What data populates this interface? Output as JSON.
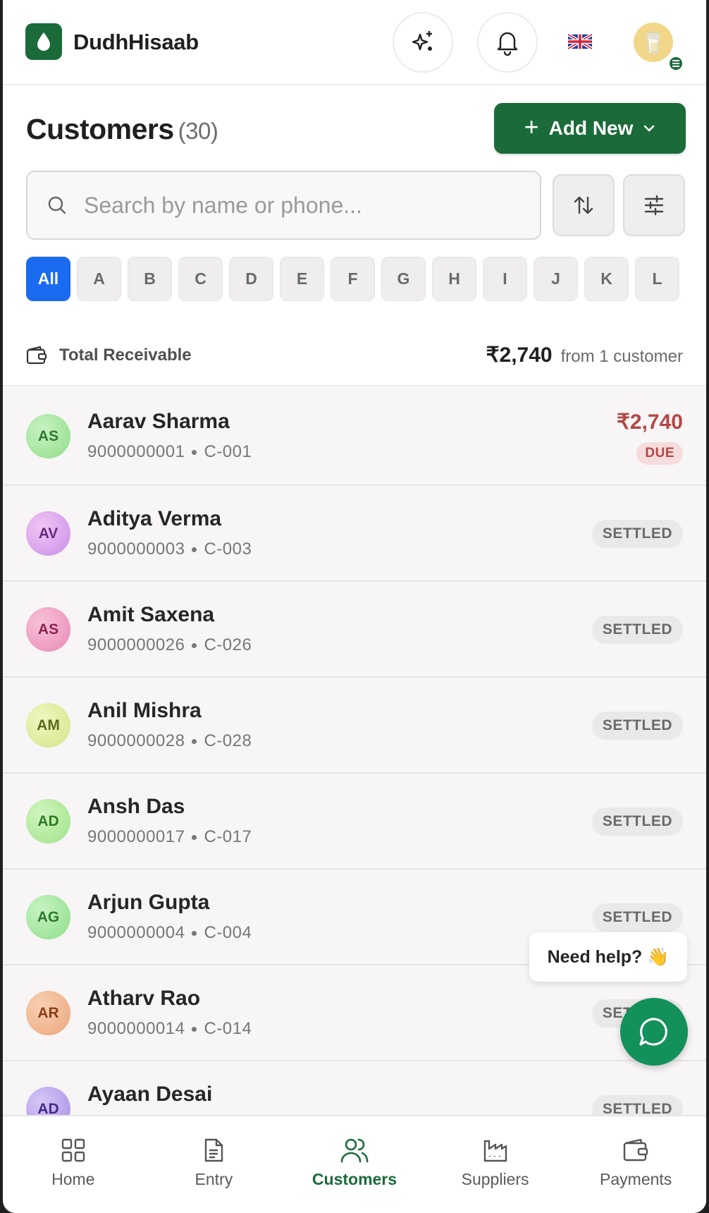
{
  "header": {
    "brand": "DudhHisaab",
    "profile_emoji": "🥛"
  },
  "page": {
    "title": "Customers",
    "count": "(30)",
    "add_new_label": "Add New"
  },
  "search": {
    "placeholder": "Search by name or phone..."
  },
  "alphabet": [
    "All",
    "A",
    "B",
    "C",
    "D",
    "E",
    "F",
    "G",
    "H",
    "I",
    "J",
    "K",
    "L"
  ],
  "receivable": {
    "label": "Total Receivable",
    "amount": "₹2,740",
    "from": "from 1 customer"
  },
  "customers": [
    {
      "initials": "AS",
      "name": "Aarav Sharma",
      "phone": "9000000001",
      "code": "C-001",
      "amount": "₹2,740",
      "status": "DUE"
    },
    {
      "initials": "AV",
      "name": "Aditya Verma",
      "phone": "9000000003",
      "code": "C-003",
      "status": "SETTLED"
    },
    {
      "initials": "AS",
      "name": "Amit Saxena",
      "phone": "9000000026",
      "code": "C-026",
      "status": "SETTLED"
    },
    {
      "initials": "AM",
      "name": "Anil Mishra",
      "phone": "9000000028",
      "code": "C-028",
      "status": "SETTLED"
    },
    {
      "initials": "AD",
      "name": "Ansh Das",
      "phone": "9000000017",
      "code": "C-017",
      "status": "SETTLED"
    },
    {
      "initials": "AG",
      "name": "Arjun Gupta",
      "phone": "9000000004",
      "code": "C-004",
      "status": "SETTLED"
    },
    {
      "initials": "AR",
      "name": "Atharv Rao",
      "phone": "9000000014",
      "code": "C-014",
      "status": "SETTLED"
    },
    {
      "initials": "AD",
      "name": "Ayaan Desai",
      "phone": "",
      "code": "",
      "status": "SETTLED"
    }
  ],
  "help": {
    "text": "Need help? 👋"
  },
  "nav": [
    {
      "label": "Home",
      "icon": "grid-icon"
    },
    {
      "label": "Entry",
      "icon": "document-icon"
    },
    {
      "label": "Customers",
      "icon": "users-icon"
    },
    {
      "label": "Suppliers",
      "icon": "factory-icon"
    },
    {
      "label": "Payments",
      "icon": "wallet-icon"
    }
  ],
  "colors": {
    "brand_green": "#1b6b3a",
    "active_blue": "#1a6bf0",
    "due_red": "#b54646",
    "chat_green": "#12915a"
  }
}
